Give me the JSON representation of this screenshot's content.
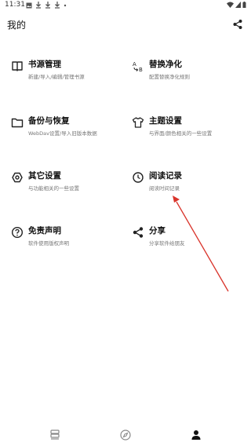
{
  "status_bar": {
    "time": "11:31"
  },
  "header": {
    "title": "我的"
  },
  "menu": [
    {
      "title": "书源管理",
      "subtitle": "新建/导入/编辑/管理书源",
      "icon": "book-icon"
    },
    {
      "title": "替换净化",
      "subtitle": "配置替换净化规则",
      "icon": "replace-ab-icon"
    },
    {
      "title": "备份与恢复",
      "subtitle": "WebDav设置/导入旧版本数据",
      "icon": "folder-icon"
    },
    {
      "title": "主题设置",
      "subtitle": "与界面/颜色相关的一些设置",
      "icon": "tshirt-icon"
    },
    {
      "title": "其它设置",
      "subtitle": "与功能相关的一些设置",
      "icon": "settings-icon"
    },
    {
      "title": "阅读记录",
      "subtitle": "阅读时间记录",
      "icon": "clock-icon"
    },
    {
      "title": "免责声明",
      "subtitle": "软件使用版权声明",
      "icon": "help-icon"
    },
    {
      "title": "分享",
      "subtitle": "分享软件给朋友",
      "icon": "share-icon"
    }
  ],
  "bottom_nav": [
    {
      "name": "bookshelf-icon"
    },
    {
      "name": "compass-icon"
    },
    {
      "name": "person-icon",
      "active": true
    }
  ],
  "annotation_color": "#d9342b"
}
